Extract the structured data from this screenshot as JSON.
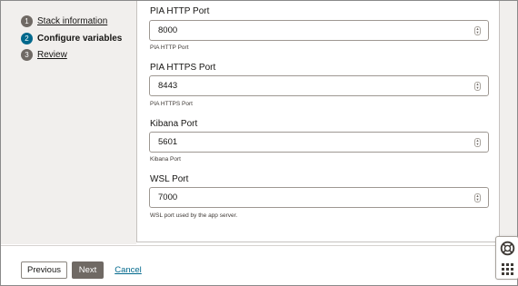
{
  "steps": [
    {
      "number": "1",
      "label": "Stack information",
      "state": "done"
    },
    {
      "number": "2",
      "label": "Configure variables",
      "state": "current"
    },
    {
      "number": "3",
      "label": "Review",
      "state": "todo"
    }
  ],
  "fields": [
    {
      "label": "PIA HTTP Port",
      "value": "8000",
      "helper": "PIA HTTP Port"
    },
    {
      "label": "PIA HTTPS Port",
      "value": "8443",
      "helper": "PIA HTTPS Port"
    },
    {
      "label": "Kibana Port",
      "value": "5601",
      "helper": "Kibana Port"
    },
    {
      "label": "WSL Port",
      "value": "7000",
      "helper": "WSL port used by the app server."
    }
  ],
  "footer": {
    "previous_label": "Previous",
    "next_label": "Next",
    "cancel_label": "Cancel"
  },
  "icons": {
    "help": "lifebuoy-icon",
    "apps": "grid-icon",
    "spinner": "spinner-arrows-icon"
  },
  "colors": {
    "accent": "#00688c",
    "step_badge": "#6f6964",
    "primary_button": "#6f6964",
    "panel_bg": "#f1efed"
  }
}
